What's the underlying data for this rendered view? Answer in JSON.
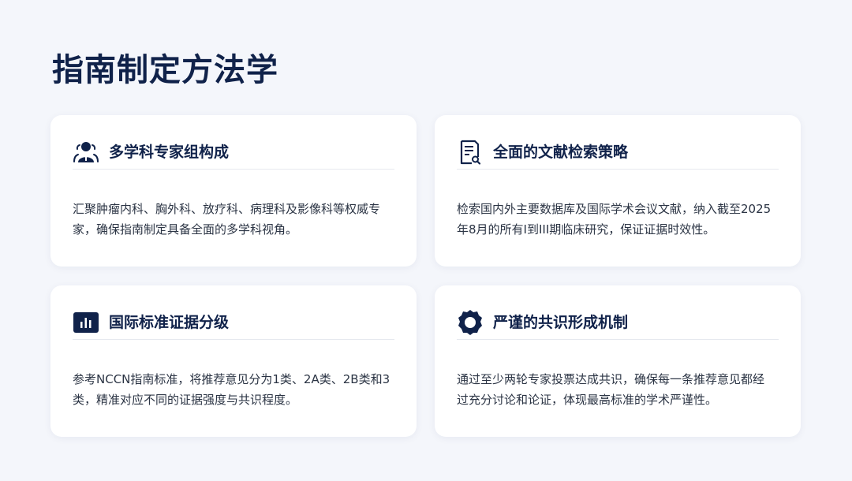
{
  "page": {
    "title": "指南制定方法学"
  },
  "cards": [
    {
      "icon": "user-group-icon",
      "title": "多学科专家组构成",
      "desc": "汇聚肿瘤内科、胸外科、放疗科、病理科及影像科等权威专家，确保指南制定具备全面的多学科视角。"
    },
    {
      "icon": "document-search-icon",
      "title": "全面的文献检索策略",
      "desc": "检索国内外主要数据库及国际学术会议文献，纳入截至2025年8月的所有I到III期临床研究，保证证据时效性。"
    },
    {
      "icon": "bar-chart-icon",
      "title": "国际标准证据分级",
      "desc": "参考NCCN指南标准，将推荐意见分为1类、2A类、2B类和3类，精准对应不同的证据强度与共识程度。"
    },
    {
      "icon": "badge-seal-icon",
      "title": "严谨的共识形成机制",
      "desc": "通过至少两轮专家投票达成共识，确保每一条推荐意见都经过充分讨论和论证，体现最高标准的学术严谨性。"
    }
  ],
  "colors": {
    "background": "#f4f6fb",
    "card": "#ffffff",
    "title": "#10224a",
    "text": "#2b3444",
    "divider": "#e6e9ef"
  }
}
